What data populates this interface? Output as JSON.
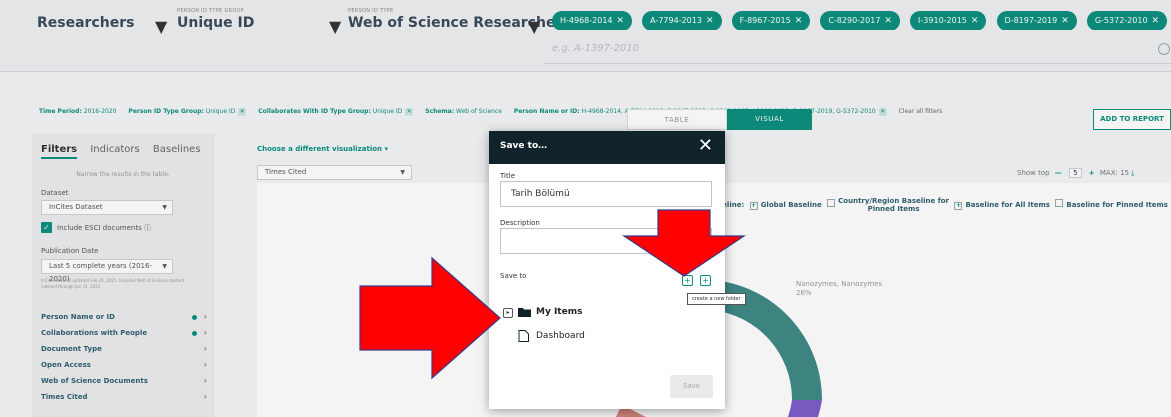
{
  "topbar": {
    "selector1": {
      "caption": "",
      "value": "Researchers"
    },
    "selector2": {
      "caption": "PERSON ID TYPE GROUP",
      "value": "Unique ID"
    },
    "selector3": {
      "caption": "PERSON ID TYPE",
      "value": "Web of Science ResearcherID"
    },
    "chips": [
      "H-4968-2014",
      "A-7794-2013",
      "F-8967-2015",
      "C-8290-2017",
      "I-3910-2015",
      "D-8197-2019",
      "G-5372-2010"
    ],
    "search_placeholder": "e.g. A-1397-2010"
  },
  "filterbar": {
    "items": [
      {
        "key": "Time Period:",
        "value": "2016-2020"
      },
      {
        "key": "Person ID Type Group:",
        "value": "Unique ID"
      },
      {
        "key": "Collaborates With ID Type Group:",
        "value": "Unique ID"
      },
      {
        "key": "Schema:",
        "value": "Web of Science"
      },
      {
        "key": "Person Name or ID:",
        "value": "H-4968-2014, A-7794-2013, F-8967-2015, C-8290-2017, I-3910-2015, D-8197-2019, G-5372-2010"
      }
    ],
    "clear_label": "Clear all filters"
  },
  "leftpanel": {
    "tabs": [
      "Filters",
      "Indicators",
      "Baselines"
    ],
    "note": "Narrow the results in the table.",
    "dataset_label": "Dataset",
    "dataset_value": "InCites Dataset",
    "esci_label": "Include ESCI documents",
    "pubdate_label": "Publication Date",
    "pubdate_value": "Last 5 complete years (2016-2020)",
    "small_note": "InCites dataset updated Feb 26, 2021. Includes Web of Science content indexed through Jan 31, 2021",
    "list": [
      {
        "label": "Person Name or ID",
        "dot": true
      },
      {
        "label": "Collaborations with People",
        "dot": true
      },
      {
        "label": "Document Type",
        "dot": false
      },
      {
        "label": "Open Access",
        "dot": false
      },
      {
        "label": "Web of Science Documents",
        "dot": false
      },
      {
        "label": "Times Cited",
        "dot": false
      }
    ]
  },
  "main": {
    "toggle_table": "TABLE",
    "toggle_visual": "VISUAL",
    "add_report": "ADD TO REPORT",
    "choose_viz": "Choose a different visualization ▾",
    "times_cited": "Times Cited",
    "show_top": "Show top",
    "show_top_value": "5",
    "max_label": "MAX: 15",
    "baseline_prefix": "seline:",
    "global_baseline": "Global Baseline",
    "country_baseline_1": "Country/Region Baseline for",
    "country_baseline_2": "Pinned Items",
    "baseline_all": "Baseline for All Items",
    "baseline_pinned": "Baseline for Pinned Items",
    "nano_label_1": "Nanozymes, Nanozymes",
    "nano_label_2": "26%"
  },
  "modal": {
    "title": "Save to…",
    "title_label": "Title",
    "title_value": "Tarih Bölümü",
    "description_label": "Description",
    "description_value": "",
    "saveto_label": "Save to",
    "tooltip": "create a new folder",
    "tree": [
      {
        "label": "My Items",
        "type": "folder"
      },
      {
        "label": "Dashboard",
        "type": "document"
      }
    ],
    "save_label": "Save"
  },
  "colors": {
    "accent": "#0b8f7d",
    "modal_header": "#10232b",
    "annotation_arrow": "#ff0000"
  }
}
